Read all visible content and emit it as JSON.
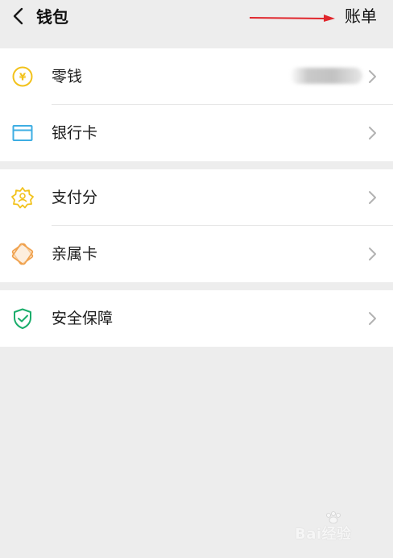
{
  "header": {
    "back_icon": "chevron-left-icon",
    "title": "钱包",
    "bills_label": "账单",
    "arrow_color": "#e0262c"
  },
  "groups": [
    {
      "items": [
        {
          "icon": "change-coin-icon",
          "label": "零钱",
          "icon_color": "#f2c21b"
        },
        {
          "icon": "bank-card-icon",
          "label": "银行卡",
          "icon_color": "#3eaee3"
        }
      ]
    },
    {
      "items": [
        {
          "icon": "pay-score-icon",
          "label": "支付分",
          "icon_color": "#f2c21b"
        },
        {
          "icon": "family-card-icon",
          "label": "亲属卡",
          "icon_color": "#f0a24e"
        }
      ]
    },
    {
      "items": [
        {
          "icon": "security-shield-icon",
          "label": "安全保障",
          "icon_color": "#1aad6b"
        }
      ]
    }
  ],
  "watermark": {
    "text": "Bai经验"
  }
}
